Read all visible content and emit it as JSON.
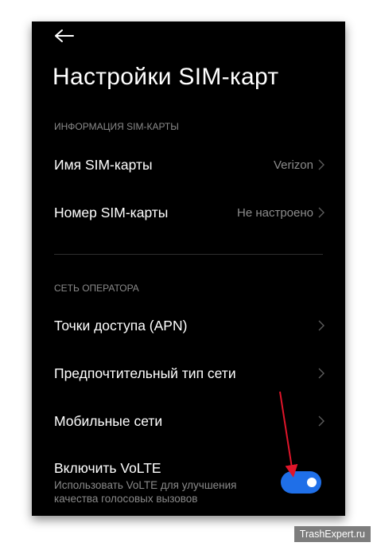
{
  "header": {
    "back_icon": "arrow-left-icon",
    "title": "Настройки SIM-карт"
  },
  "sim_info": {
    "section_title": "ИНФОРМАЦИЯ SIM-КАРТЫ",
    "sim_name": {
      "label": "Имя SIM-карты",
      "value": "Verizon"
    },
    "sim_number": {
      "label": "Номер SIM-карты",
      "value": "Не настроено"
    }
  },
  "network": {
    "section_title": "СЕТЬ ОПЕРАТОРА",
    "apn": {
      "label": "Точки доступа (APN)"
    },
    "preferred_network": {
      "label": "Предпочтительный тип сети"
    },
    "mobile_networks": {
      "label": "Мобильные сети"
    },
    "volte": {
      "label": "Включить VoLTE",
      "description": "Использовать VoLTE для улучшения качества голосовых вызовов",
      "enabled": true
    }
  },
  "annotation": {
    "arrow_color": "#e0152a"
  },
  "colors": {
    "accent": "#1f6fe8",
    "background": "#000000"
  },
  "watermark": "TrashExpert.ru"
}
